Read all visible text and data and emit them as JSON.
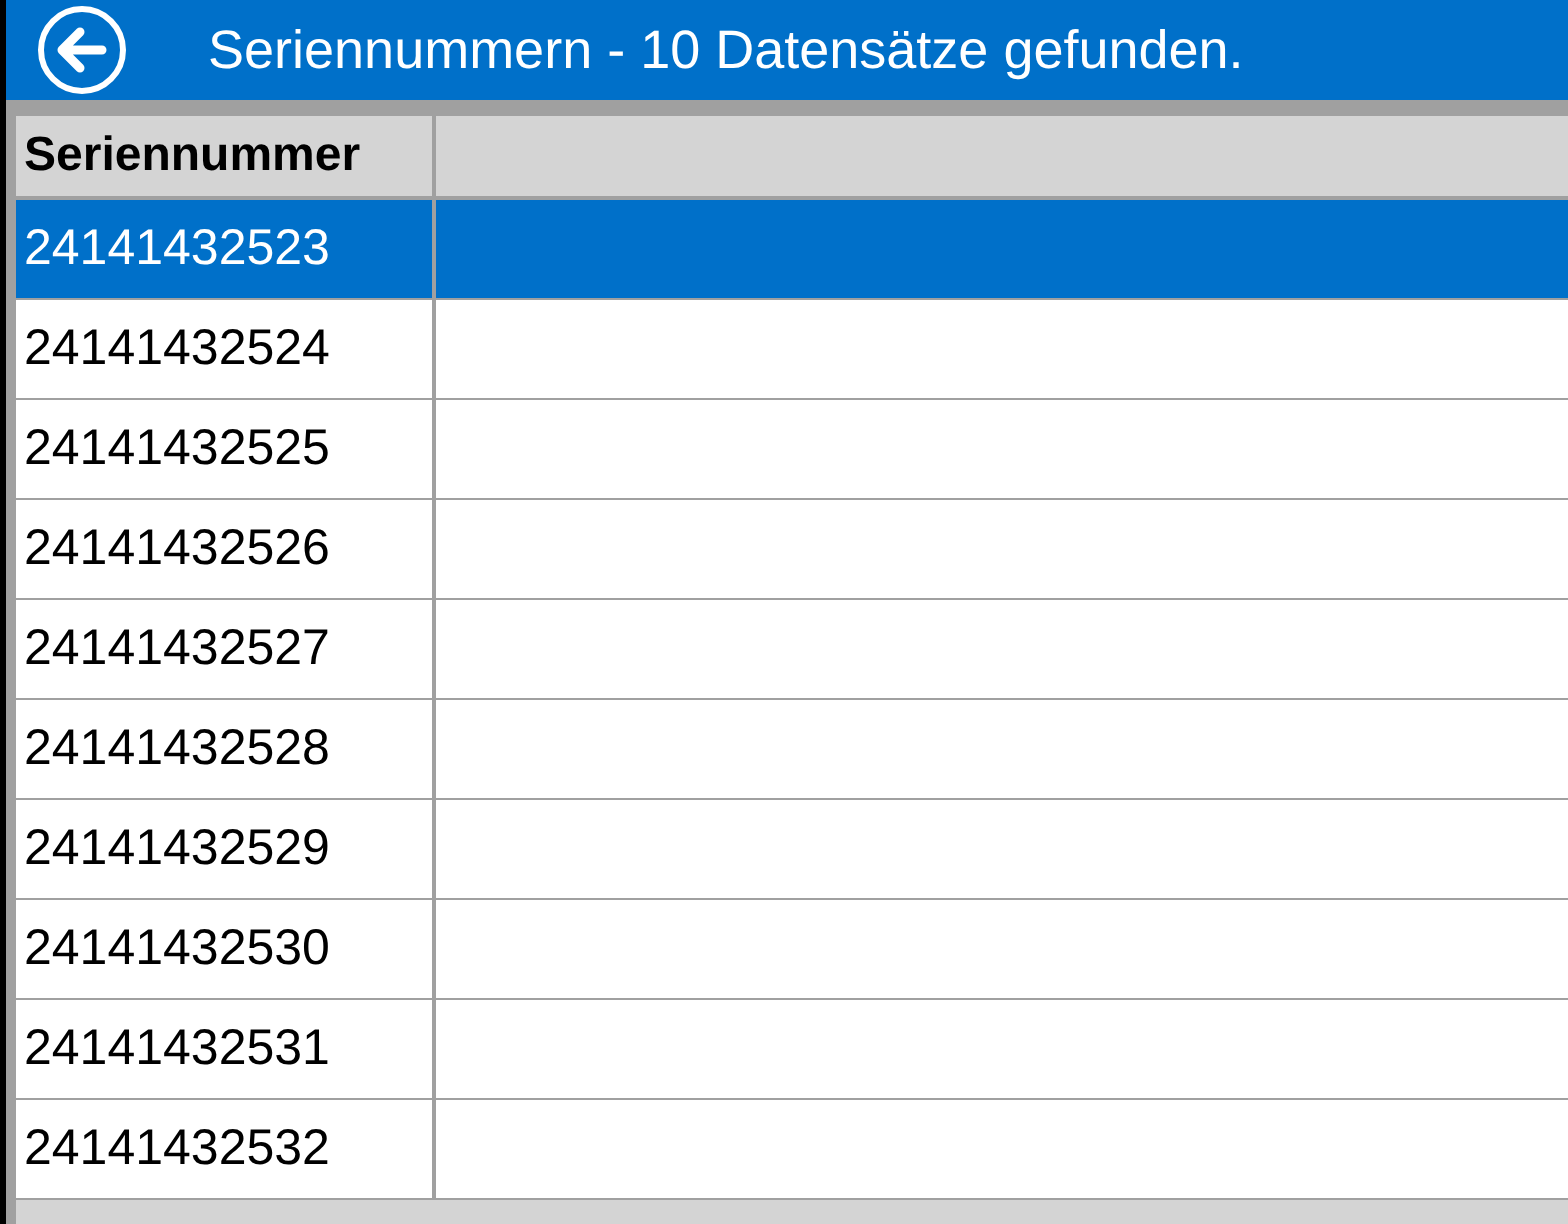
{
  "header": {
    "title": "Seriennummern - 10 Datensätze gefunden."
  },
  "table": {
    "columns": [
      "Seriennummer"
    ],
    "rows": [
      {
        "cells": [
          "24141432523"
        ],
        "selected": true
      },
      {
        "cells": [
          "24141432524"
        ],
        "selected": false
      },
      {
        "cells": [
          "24141432525"
        ],
        "selected": false
      },
      {
        "cells": [
          "24141432526"
        ],
        "selected": false
      },
      {
        "cells": [
          "24141432527"
        ],
        "selected": false
      },
      {
        "cells": [
          "24141432528"
        ],
        "selected": false
      },
      {
        "cells": [
          "24141432529"
        ],
        "selected": false
      },
      {
        "cells": [
          "24141432530"
        ],
        "selected": false
      },
      {
        "cells": [
          "24141432531"
        ],
        "selected": false
      },
      {
        "cells": [
          "24141432532"
        ],
        "selected": false
      }
    ]
  }
}
